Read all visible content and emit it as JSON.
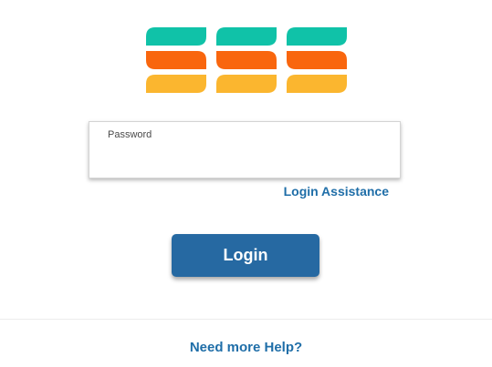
{
  "logo": {
    "name": "ess-logo",
    "colors": {
      "top": "#10c2a8",
      "middle": "#f9660e",
      "bottom": "#fbb62f"
    }
  },
  "password": {
    "label": "Password",
    "value": ""
  },
  "links": {
    "login_assistance": "Login Assistance",
    "need_help": "Need more Help?"
  },
  "login_button": {
    "label": "Login"
  },
  "colors": {
    "accent": "#2669a2",
    "link": "#1f6ea8"
  }
}
